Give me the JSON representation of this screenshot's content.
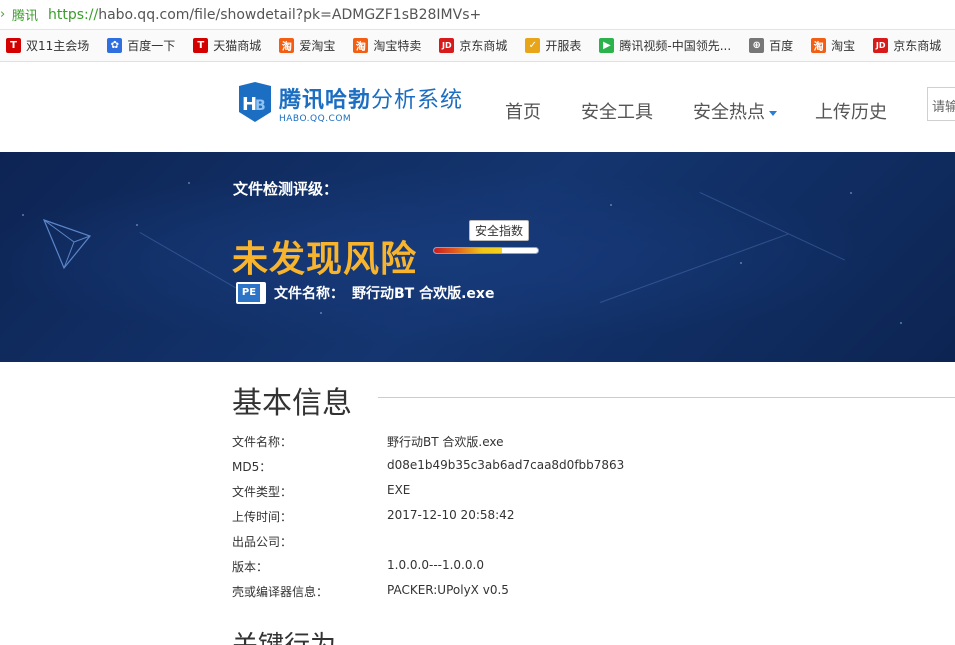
{
  "browser": {
    "site_name": "腾讯",
    "url_scheme": "https://",
    "url_rest": "habo.qq.com/file/showdetail?pk=ADMGZF1sB28IMVs+"
  },
  "bookmarks": [
    {
      "label": "双11主会场",
      "icon": "tmall-t-icon",
      "color": "#d40000",
      "glyph": "T"
    },
    {
      "label": "百度一下",
      "icon": "baidu-paw-icon",
      "color": "#2f6fe0",
      "glyph": "✿"
    },
    {
      "label": "天猫商城",
      "icon": "tmall-t-icon",
      "color": "#d40000",
      "glyph": "T"
    },
    {
      "label": "爱淘宝",
      "icon": "taobao-icon",
      "color": "#f45e12",
      "glyph": "淘"
    },
    {
      "label": "淘宝特卖",
      "icon": "taobao-icon",
      "color": "#f45e12",
      "glyph": "淘"
    },
    {
      "label": "京东商城",
      "icon": "jd-icon",
      "color": "#d71a1a",
      "glyph": "JD"
    },
    {
      "label": "开服表",
      "icon": "game-icon",
      "color": "#e8a51a",
      "glyph": "✓"
    },
    {
      "label": "腾讯视频-中国领先...",
      "icon": "tencent-video-icon",
      "color": "#2bb24c",
      "glyph": "▶"
    },
    {
      "label": "百度",
      "icon": "globe-icon",
      "color": "#777777",
      "glyph": "⊕"
    },
    {
      "label": "淘宝",
      "icon": "taobao-icon",
      "color": "#f45e12",
      "glyph": "淘"
    },
    {
      "label": "京东商城",
      "icon": "jd-icon",
      "color": "#d71a1a",
      "glyph": "JD"
    }
  ],
  "header": {
    "logo_title_bold": "腾讯哈勃",
    "logo_title_rest": "分析系统",
    "logo_sub": "HABO.QQ.COM",
    "nav": [
      "首页",
      "安全工具",
      "安全热点",
      "上传历史"
    ],
    "search_placeholder": "请输"
  },
  "banner": {
    "label": "文件检测评级：",
    "verdict": "未发现风险",
    "gauge_label": "安全指数",
    "gauge_level": 0.65,
    "file_label": "文件名称：",
    "file_name": "野行动BT 合欢版.exe",
    "file_icon_text": "PE"
  },
  "info": {
    "title": "基本信息",
    "rows": [
      {
        "k": "文件名称：",
        "v": "野行动BT 合欢版.exe"
      },
      {
        "k": "MD5：",
        "v": "d08e1b49b35c3ab6ad7caa8d0fbb7863"
      },
      {
        "k": "文件类型：",
        "v": "EXE"
      },
      {
        "k": "上传时间：",
        "v": "2017-12-10 20:58:42"
      },
      {
        "k": "出品公司：",
        "v": ""
      },
      {
        "k": "版本：",
        "v": "1.0.0.0---1.0.0.0"
      },
      {
        "k": "壳或编译器信息：",
        "v": "PACKER:UPolyX v0.5"
      }
    ],
    "next_title": "关键行为"
  },
  "colors": {
    "banner_bg": "#0f2b60",
    "verdict": "#f7b42c",
    "brand": "#1b6ec2"
  }
}
